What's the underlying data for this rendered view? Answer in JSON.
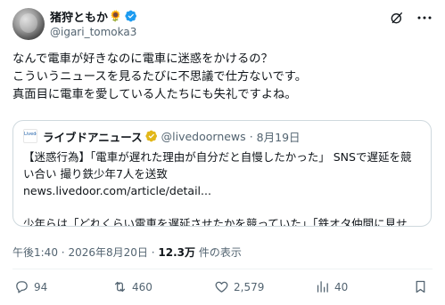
{
  "author": {
    "display_name": "猪狩ともか",
    "emoji": "🌻",
    "handle": "@igari_tomoka3"
  },
  "tweet": {
    "lines": [
      "なんで電車が好きなのに電車に迷惑をかけるの？",
      "こういうニュースを見るたびに不思議で仕方ないです。",
      "真面目に電車を愛している人たちにも失礼ですよね。"
    ]
  },
  "quote": {
    "logo_text": "Livedoor News",
    "name": "ライブドアニュース",
    "handle": "@livedoornews",
    "separator": "·",
    "date": "8月19日",
    "lines": [
      "【迷惑行為】「電車が遅れた理由が自分だと自慢したかった」 SNSで遅延を競",
      "い合い 撮り鉄少年7人を送致",
      "news.livedoor.com/article/detail...",
      "",
      "少年らは「どれくらい電車を遅延させたかを競っていた」「鉄オタ仲間に見せ…"
    ]
  },
  "meta": {
    "time": "午後1:40",
    "separator": "·",
    "date": "2026年8月20日",
    "views_count": "12.3万",
    "views_label": "件の表示"
  },
  "actions": {
    "replies": "94",
    "retweets": "460",
    "likes": "2,579",
    "views": "40"
  },
  "colors": {
    "text": "#0f1419",
    "secondary": "#536471",
    "border": "#cfd9de",
    "verified_blue": "#1d9bf0",
    "verified_gold": "#e2b719"
  }
}
